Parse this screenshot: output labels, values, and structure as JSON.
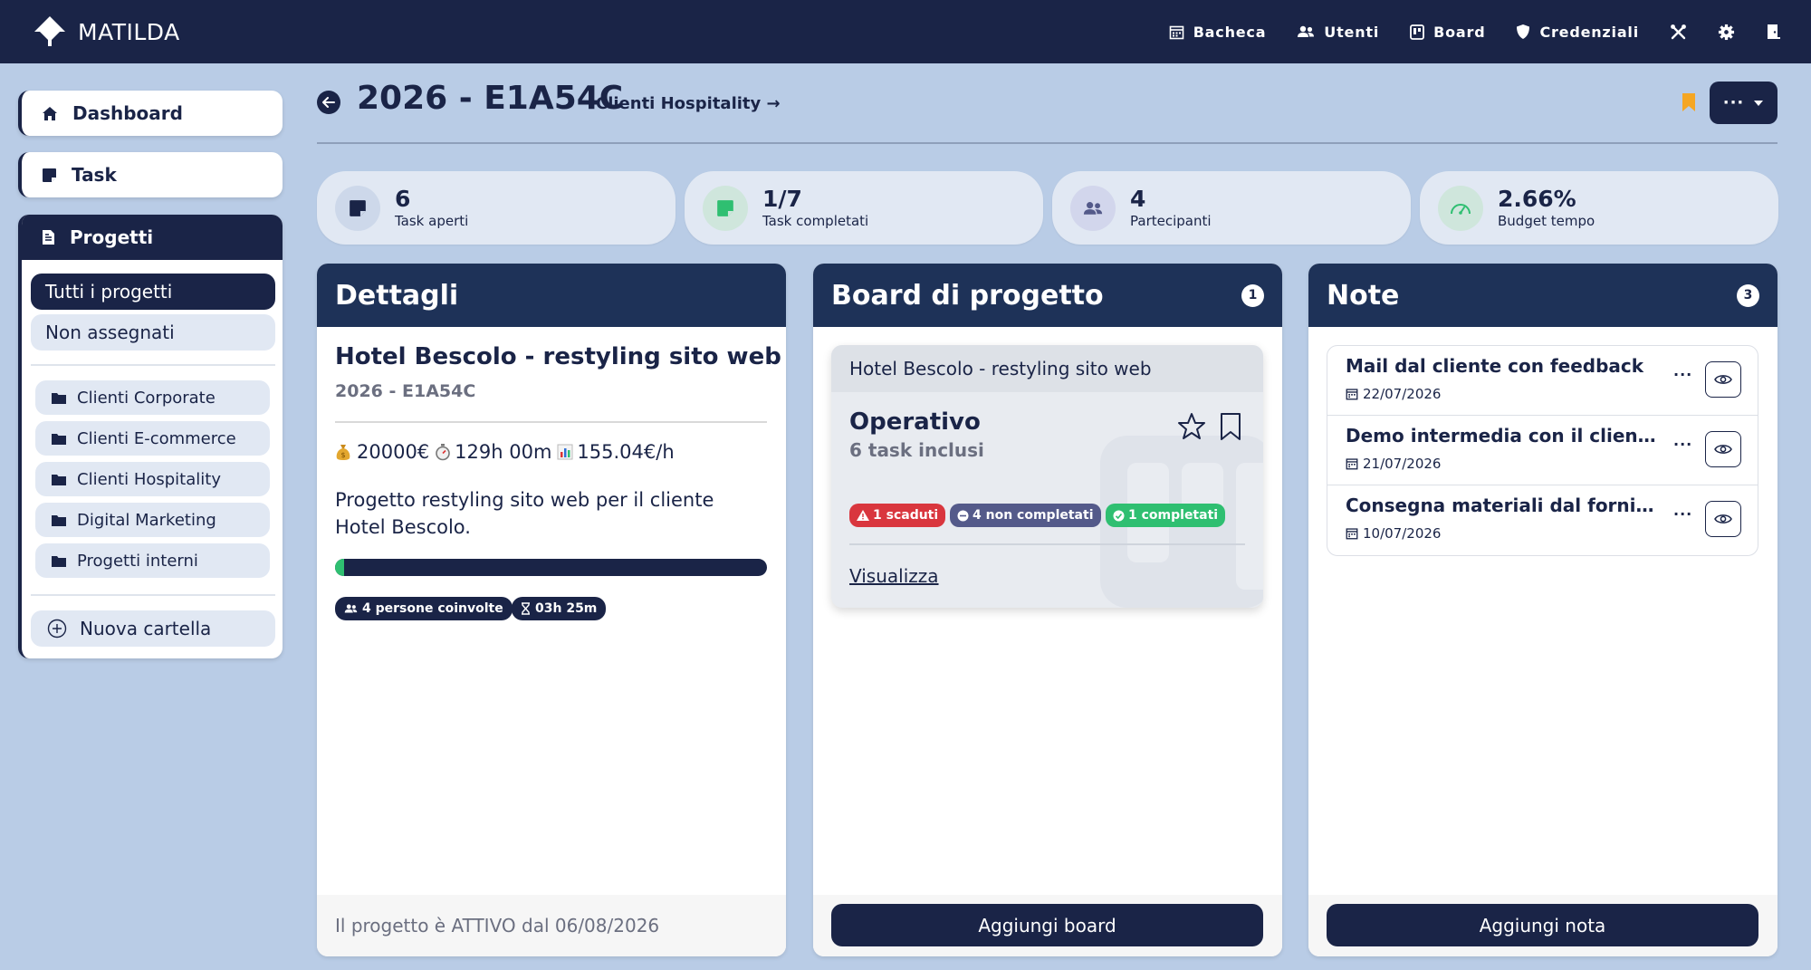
{
  "app": {
    "name": "MATILDA"
  },
  "nav": {
    "items": [
      {
        "label": "Bacheca",
        "icon": "calendar-icon"
      },
      {
        "label": "Utenti",
        "icon": "users-icon"
      },
      {
        "label": "Board",
        "icon": "board-icon"
      },
      {
        "label": "Credenziali",
        "icon": "shield-icon"
      }
    ],
    "icons": [
      "tools-icon",
      "gear-icon",
      "logout-icon"
    ]
  },
  "sidebar": {
    "dashboard": "Dashboard",
    "task": "Task",
    "progetti": "Progetti",
    "filters": [
      "Tutti i progetti",
      "Non assegnati"
    ],
    "folders": [
      "Clienti Corporate",
      "Clienti E-commerce",
      "Clienti Hospitality",
      "Digital Marketing",
      "Progetti interni"
    ],
    "new_folder": "Nuova cartella"
  },
  "header": {
    "title": "2026 - E1A54C",
    "client_link": "Clienti Hospitality →",
    "menu_label": "···"
  },
  "stats": [
    {
      "value": "6",
      "label": "Task aperti",
      "icon": "sticky-note-icon"
    },
    {
      "value": "1/7",
      "label": "Task completati",
      "icon": "sticky-note-check-icon"
    },
    {
      "value": "4",
      "label": "Partecipanti",
      "icon": "users-icon"
    },
    {
      "value": "2.66%",
      "label": "Budget tempo",
      "icon": "gauge-icon"
    }
  ],
  "details": {
    "heading": "Dettagli",
    "project_name": "Hotel Bescolo - restyling sito web",
    "code": "2026 - E1A54C",
    "budget": "20000€",
    "hours": "129h 00m",
    "rate": "155.04€/h",
    "description": "Progetto restyling sito web per il cliente Hotel Bescolo.",
    "progress": 0.02,
    "people_chip": "4 persone coinvolte",
    "time_chip": "03h 25m",
    "status_text": "Il progetto è ATTIVO dal 06/08/2026"
  },
  "board": {
    "heading": "Board di progetto",
    "count": "1",
    "card": {
      "project": "Hotel Bescolo - restyling sito web",
      "name": "Operativo",
      "subtitle": "6 task inclusi",
      "tags": {
        "overdue": "1 scaduti",
        "incomplete": "4 non completati",
        "completed": "1 completati"
      },
      "link": "Visualizza"
    },
    "add_button": "Aggiungi board"
  },
  "notes": {
    "heading": "Note",
    "count": "3",
    "items": [
      {
        "title": "Mail dal cliente con feedback",
        "date": "22/07/2026"
      },
      {
        "title": "Demo intermedia con il cliente",
        "date": "21/07/2026"
      },
      {
        "title": "Consegna materiali dal fornitore",
        "date": "10/07/2026"
      }
    ],
    "add_button": "Aggiungi nota"
  },
  "colors": {
    "navy": "#1a2447",
    "background": "#b9cce6",
    "success": "#2fbf71",
    "danger": "#d9363e",
    "muted_badge": "#545a8a",
    "bookmark": "#f5a623"
  }
}
